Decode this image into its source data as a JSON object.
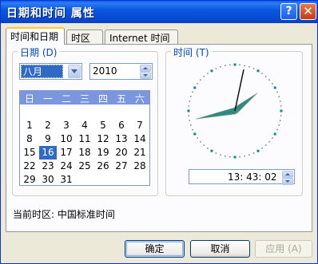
{
  "window": {
    "title": "日期和时间 属性",
    "help_glyph": "?",
    "close_glyph": "✕"
  },
  "tabs": [
    {
      "label": "时间和日期",
      "active": true
    },
    {
      "label": "时区",
      "active": false
    },
    {
      "label": "Internet 时间",
      "active": false
    }
  ],
  "date_group": {
    "legend": "日期 (D)",
    "month": "八月",
    "year": "2010",
    "weekdays": [
      "日",
      "一",
      "二",
      "三",
      "四",
      "五",
      "六"
    ],
    "weeks": [
      [
        "",
        "",
        "",
        "",
        "",
        "",
        ""
      ],
      [
        "1",
        "2",
        "3",
        "4",
        "5",
        "6",
        "7"
      ],
      [
        "8",
        "9",
        "10",
        "11",
        "12",
        "13",
        "14"
      ],
      [
        "15",
        "16",
        "17",
        "18",
        "19",
        "20",
        "21"
      ],
      [
        "22",
        "23",
        "24",
        "25",
        "26",
        "27",
        "28"
      ],
      [
        "29",
        "30",
        "31",
        "",
        "",
        "",
        ""
      ]
    ],
    "selected_day": "16"
  },
  "time_group": {
    "legend": "时间 (T)",
    "time_text": "13: 43: 02",
    "clock": {
      "hour": 13,
      "minute": 43,
      "second": 2
    },
    "colors": {
      "hand": "#2e8b80",
      "dot": "#0b8a8a"
    }
  },
  "timezone": {
    "label": "当前时区:",
    "value": "中国标准时间"
  },
  "buttons": {
    "ok": "确定",
    "cancel": "取消",
    "apply": "应用 (A)"
  },
  "colors": {
    "title_bar": "#0a5fe8",
    "selection": "#316ac5",
    "legend": "#0046d5",
    "calendar_header": "#7a96df"
  }
}
